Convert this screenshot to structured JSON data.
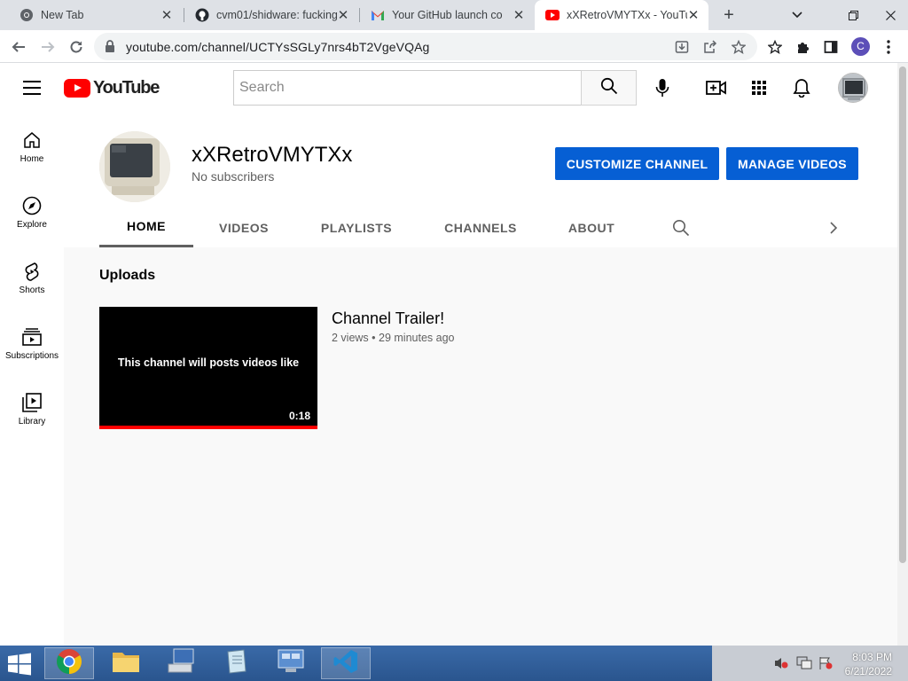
{
  "browser": {
    "tabs": [
      {
        "title": "New Tab",
        "icon": "chrome-icon"
      },
      {
        "title": "cvm01/shidware: fucking",
        "icon": "github-icon"
      },
      {
        "title": "Your GitHub launch co",
        "icon": "gmail-icon"
      },
      {
        "title": "xXRetroVMYTXx - YouTube",
        "icon": "youtube-icon",
        "active": true
      }
    ],
    "new_tab": "+",
    "url": "youtube.com/channel/UCTYsSGLy7nrs4bT2VgeVQAg",
    "profile_initial": "C"
  },
  "youtube": {
    "logo_text": "YouTube",
    "search_placeholder": "Search",
    "guide": [
      {
        "label": "Home",
        "icon": "home-icon"
      },
      {
        "label": "Explore",
        "icon": "compass-icon"
      },
      {
        "label": "Shorts",
        "icon": "shorts-icon"
      },
      {
        "label": "Subscriptions",
        "icon": "subscriptions-icon"
      },
      {
        "label": "Library",
        "icon": "library-icon"
      }
    ],
    "channel": {
      "name": "xXRetroVMYTXx",
      "subscribers": "No subscribers",
      "customize_label": "CUSTOMIZE CHANNEL",
      "manage_label": "MANAGE VIDEOS",
      "tabs": [
        "HOME",
        "VIDEOS",
        "PLAYLISTS",
        "CHANNELS",
        "ABOUT"
      ],
      "active_tab": "HOME"
    },
    "uploads": {
      "title": "Uploads",
      "video": {
        "thumb_text": "This channel will posts videos like",
        "duration": "0:18",
        "title": "Channel Trailer!",
        "meta": "2 views • 29 minutes ago",
        "watched_fraction": 1.0
      }
    }
  },
  "taskbar": {
    "clock_time": "8:03 PM",
    "clock_date": "6/21/2022"
  },
  "colors": {
    "yt_red": "#ff0000",
    "yt_blue": "#065fd4",
    "taskbar": "#2b5797"
  }
}
